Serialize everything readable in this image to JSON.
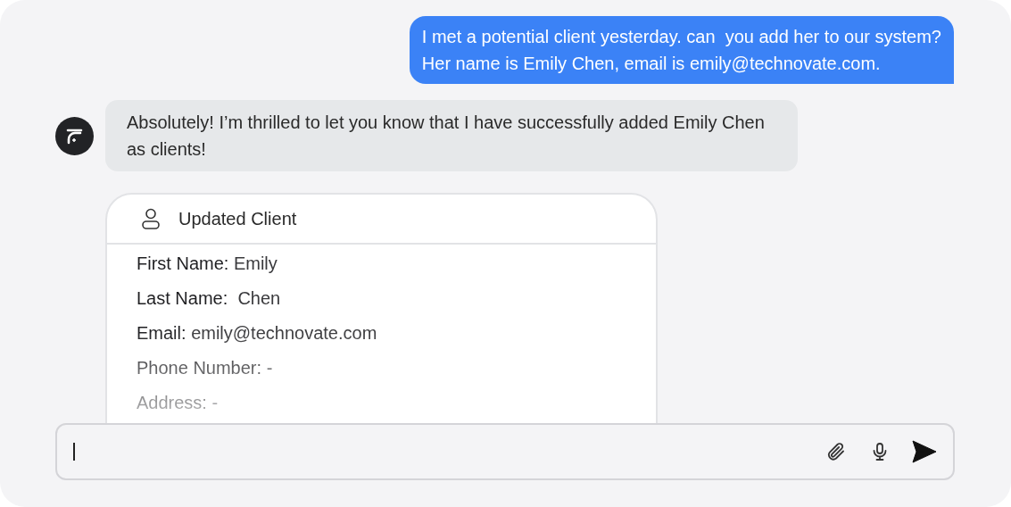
{
  "messages": [
    {
      "kind": "user",
      "text": "I met a potential client yesterday. can  you add her to our system?\nHer name is Emily Chen, email is emily@technovate.com."
    },
    {
      "kind": "assistant",
      "text": "Absolutely! I’m thrilled to let you know that I have successfully added Emily Chen as clients!"
    }
  ],
  "client_card": {
    "title": "Updated Client",
    "fields": [
      "**First Name:** Emily",
      "**Last Name:**  Chen",
      "**Email:** emily@technovate.com",
      "**Phone Number:** -",
      "**Address:** -"
    ]
  }
}
